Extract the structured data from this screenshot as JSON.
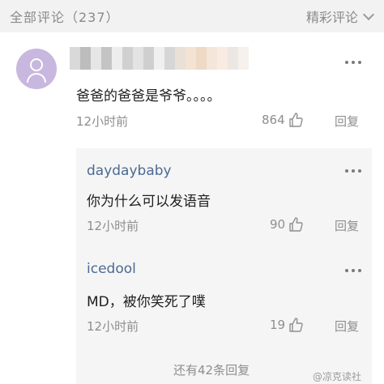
{
  "header": {
    "title": "全部评论（237）",
    "sort_label": "精彩评论"
  },
  "comment": {
    "text": "爸爸的爸爸是爷爷。。。。",
    "time": "12小时前",
    "likes": "864",
    "reply_label": "回复"
  },
  "replies": [
    {
      "user": "daydaybaby",
      "text": "你为什么可以发语音",
      "time": "12小时前",
      "likes": "90",
      "reply_label": "回复"
    },
    {
      "user": "icedool",
      "text": "MD，被你笑死了噗",
      "time": "12小时前",
      "likes": "19",
      "reply_label": "回复"
    }
  ],
  "more_replies": "还有42条回复",
  "watermark": "@凉克读社",
  "colors": {
    "username": "#4c6a93",
    "meta": "#8e8e8e",
    "avatar": "#c8b7de",
    "reply_bg": "#f5f5f5"
  }
}
